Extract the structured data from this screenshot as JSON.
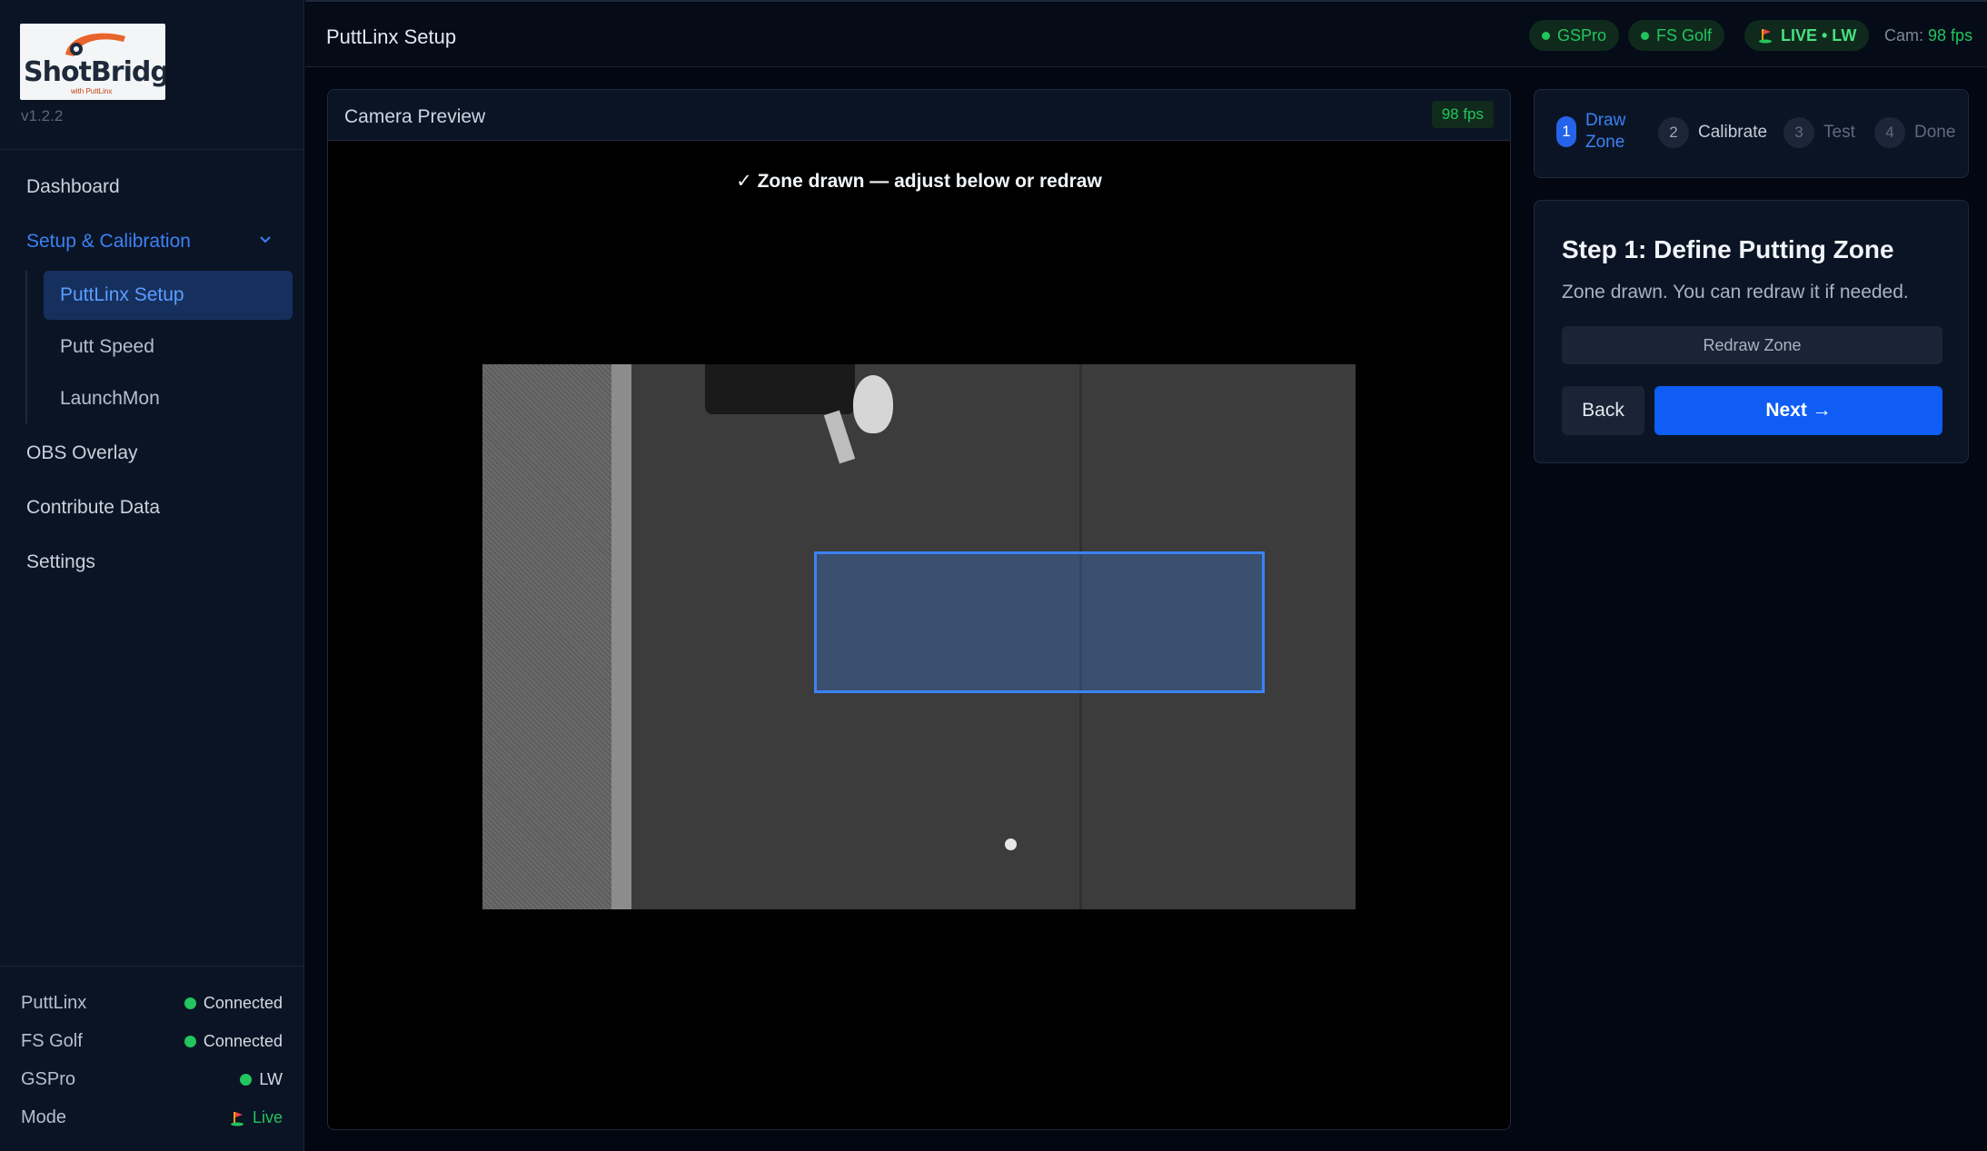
{
  "brand": {
    "logo_text_a": "Shot",
    "logo_text_b": "Bridge",
    "logo_sub": "with PuttLinx",
    "version": "v1.2.2"
  },
  "nav": {
    "dashboard": "Dashboard",
    "setup": "Setup & Calibration",
    "sub": [
      "PuttLinx Setup",
      "Putt Speed",
      "LaunchMon"
    ],
    "obs": "OBS Overlay",
    "contribute": "Contribute Data",
    "settings": "Settings"
  },
  "status": [
    {
      "label": "PuttLinx",
      "value": "Connected"
    },
    {
      "label": "FS Golf",
      "value": "Connected"
    },
    {
      "label": "GSPro",
      "value": "LW"
    },
    {
      "label": "Mode",
      "value": "Live"
    }
  ],
  "topbar": {
    "title": "PuttLinx Setup",
    "pills": [
      "GSPro",
      "FS Golf",
      "LIVE • LW"
    ],
    "cam_label": "Cam:",
    "cam_fps": "98 fps"
  },
  "preview": {
    "title": "Camera Preview",
    "fps": "98 fps",
    "message": "✓ Zone drawn — adjust below or redraw"
  },
  "steps": [
    {
      "num": "1",
      "label": "Draw Zone"
    },
    {
      "num": "2",
      "label": "Calibrate"
    },
    {
      "num": "3",
      "label": "Test"
    },
    {
      "num": "4",
      "label": "Done"
    }
  ],
  "card": {
    "title": "Step 1: Define Putting Zone",
    "desc": "Zone drawn. You can redraw it if needed.",
    "redraw": "Redraw Zone",
    "back": "Back",
    "next": "Next →"
  },
  "colors": {
    "accent": "#3b82f6",
    "success": "#22c55e",
    "primary_button": "#0f5df5"
  }
}
